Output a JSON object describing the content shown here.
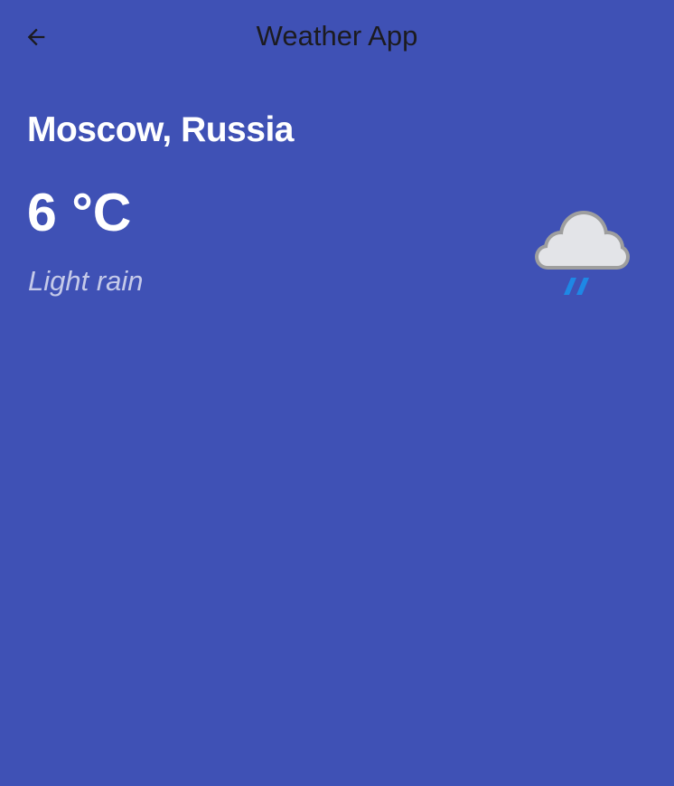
{
  "app_bar": {
    "title": "Weather App",
    "back_icon": "arrow-back-icon"
  },
  "weather": {
    "city": "Moscow, Russia",
    "temperature": "6 °C",
    "description": "Light rain",
    "icon": "cloud-rain-icon"
  },
  "colors": {
    "background": "#3F51B5",
    "title_text": "#1C1B1F",
    "primary_text": "#FFFFFF",
    "secondary_text": "#C5CAE9",
    "rain_drops": "#1E88E5"
  }
}
